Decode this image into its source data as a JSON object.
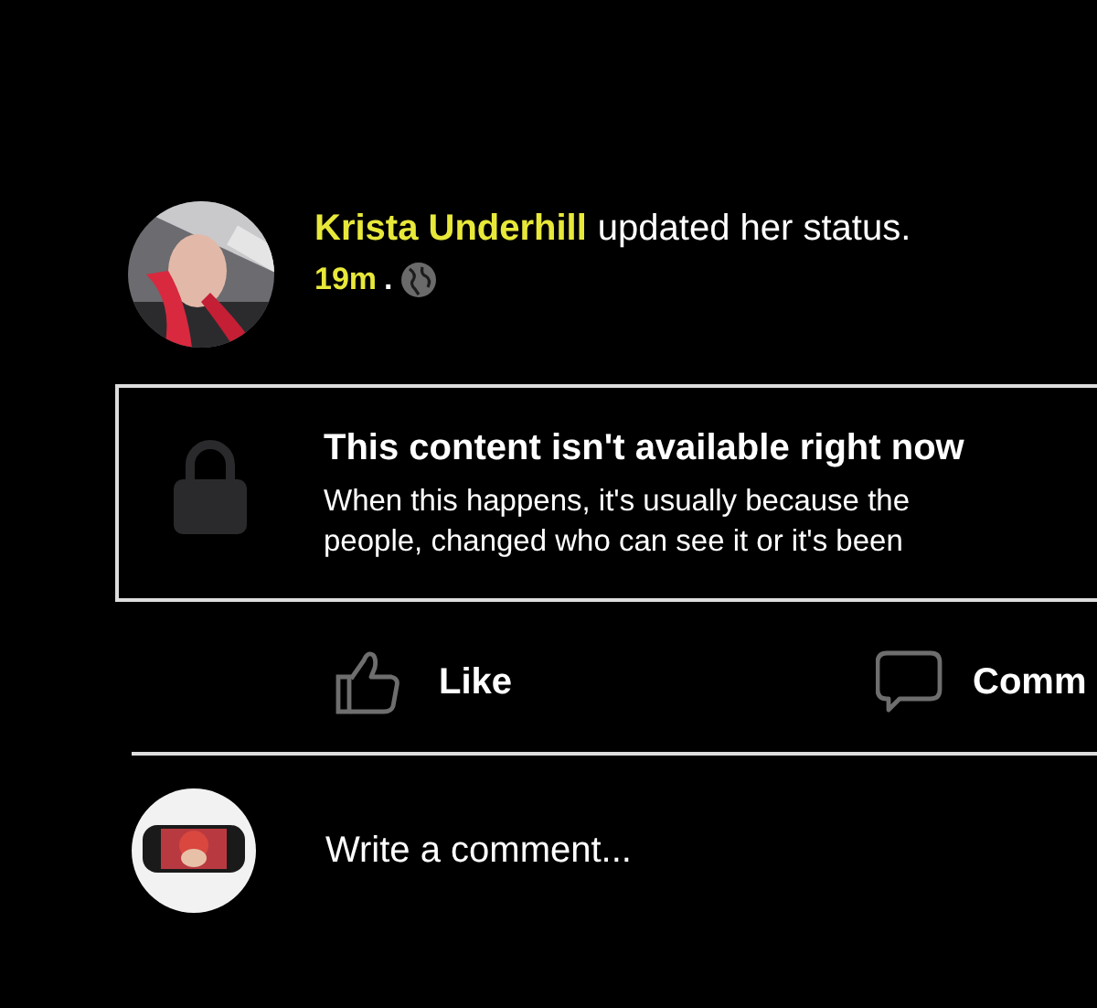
{
  "post": {
    "author": "Krista Underhill",
    "action": "updated her status.",
    "time": "19m",
    "separator": ".",
    "notice": {
      "title": "This content isn't available right now",
      "lines": [
        "When this happens, it's usually because the",
        "people, changed who can see it or it's been"
      ]
    }
  },
  "actions": [
    {
      "kind": "like",
      "label": "Like"
    },
    {
      "kind": "comment",
      "label": "Comm"
    }
  ],
  "comment_box": {
    "placeholder": "Write a comment..."
  }
}
